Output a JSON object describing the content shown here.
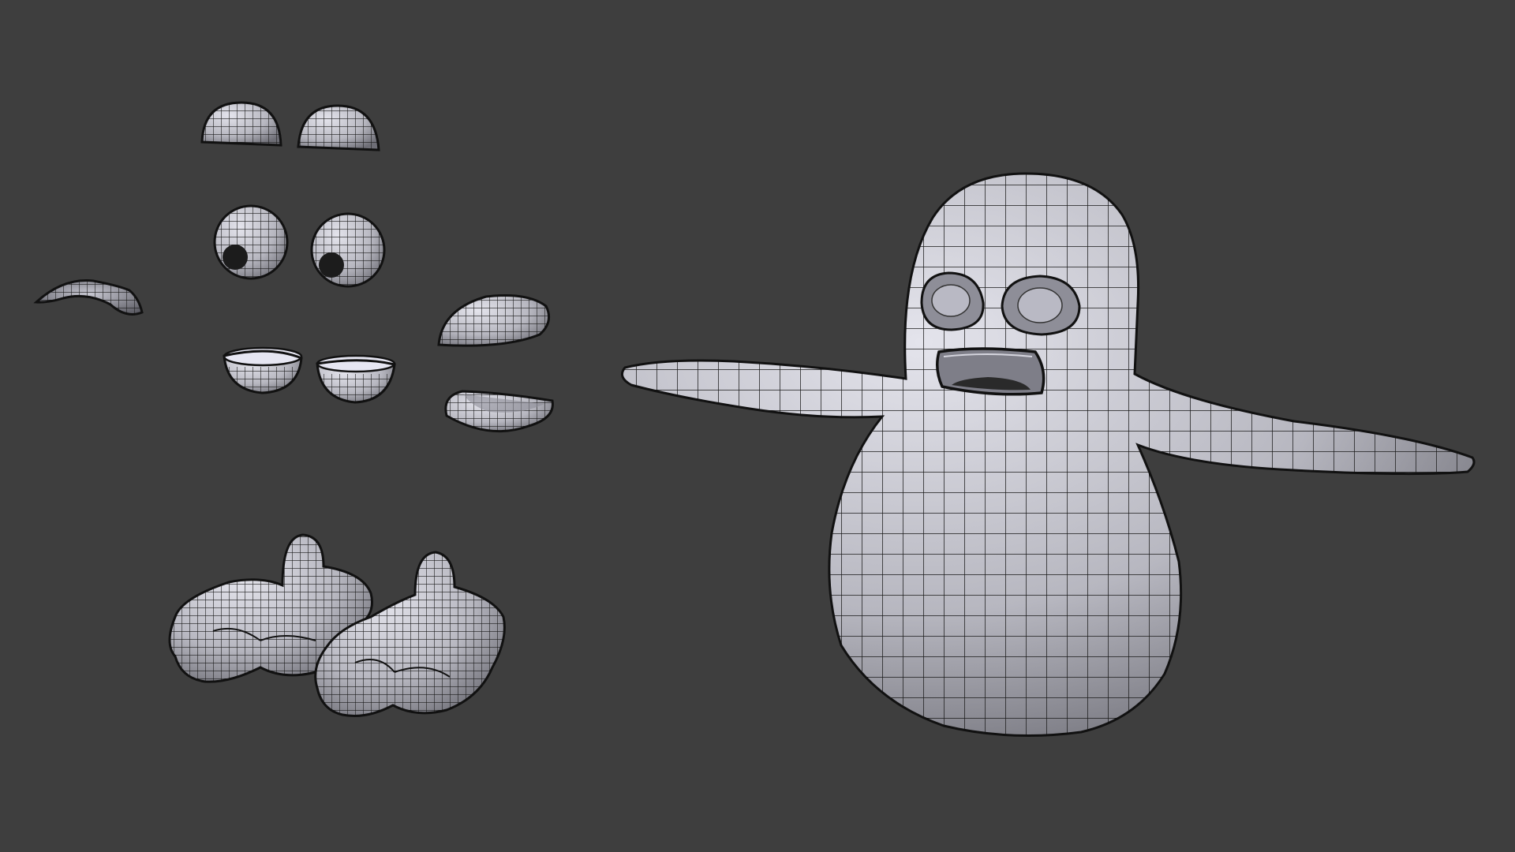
{
  "viewport": {
    "background_color": "#3e3e3e",
    "mesh_fill_color": "#c7c7cf",
    "mesh_shade_color": "#7c7c84",
    "wire_color": "#1a1a1a"
  },
  "objects": [
    {
      "id": "ear-cup-left",
      "type": "half-sphere"
    },
    {
      "id": "ear-cup-right",
      "type": "half-sphere"
    },
    {
      "id": "eyeball-left",
      "type": "sphere"
    },
    {
      "id": "eyeball-right",
      "type": "sphere"
    },
    {
      "id": "eyebrow",
      "type": "curved-strip"
    },
    {
      "id": "eye-socket-left",
      "type": "bowl"
    },
    {
      "id": "eye-socket-right",
      "type": "bowl"
    },
    {
      "id": "beak-upper",
      "type": "rounded-wedge"
    },
    {
      "id": "beak-lower",
      "type": "rounded-wedge"
    },
    {
      "id": "foot-left",
      "type": "foot"
    },
    {
      "id": "foot-right",
      "type": "foot"
    },
    {
      "id": "penguin-body",
      "type": "body-mesh"
    }
  ]
}
